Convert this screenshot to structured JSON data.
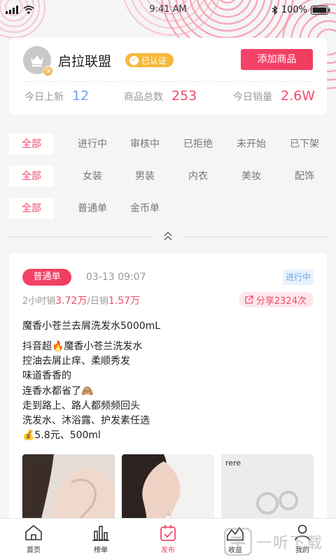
{
  "status_bar": {
    "time": "9:41 AM",
    "battery": "100%"
  },
  "shop": {
    "name": "启拉联盟",
    "avatar_badge": "保",
    "verified_label": "已认证",
    "add_button": "添加商品",
    "stats": [
      {
        "label": "今日上新",
        "value": "12"
      },
      {
        "label": "商品总数",
        "value": "253"
      },
      {
        "label": "今日销量",
        "value": "2.6W"
      }
    ]
  },
  "filters": {
    "status": [
      "全部",
      "进行中",
      "审核中",
      "已拒绝",
      "未开始",
      "已下架"
    ],
    "category": [
      "全部",
      "女装",
      "男装",
      "内衣",
      "美妆",
      "配饰"
    ],
    "type": [
      "全部",
      "普通单",
      "金币单"
    ]
  },
  "post": {
    "type_tag": "普通单",
    "time": "03-13 09:07",
    "status": "进行中",
    "sales_2h_label": "2小时销",
    "sales_2h_value": "3.72万",
    "separator": "/",
    "sales_day_label": "日销",
    "sales_day_value": "1.57万",
    "share_label": "分享2324次",
    "title": "魔香小苍兰去屑洗发水5000mL",
    "body_lines": [
      "抖音超🔥魔香小苍兰洗发水",
      "控油去屑止痒、柔顺秀发",
      "味道香香的",
      "连香水都省了🙈",
      "走到路上、路人都频频回头",
      "洗发水、沐浴露、护发素任选",
      "💰5.8元、500ml"
    ],
    "image_brands": [
      "rere",
      "",
      "rere"
    ]
  },
  "tabs": [
    {
      "label": "首页",
      "icon": "home-icon"
    },
    {
      "label": "榜单",
      "icon": "ranking-icon"
    },
    {
      "label": "发布",
      "icon": "publish-icon"
    },
    {
      "label": "收益",
      "icon": "earnings-icon"
    },
    {
      "label": "我的",
      "icon": "profile-icon"
    }
  ],
  "watermark": "一听下载",
  "colors": {
    "accent": "#f04b6b",
    "blue": "#6aa6e8",
    "gold": "#f5b93a"
  }
}
